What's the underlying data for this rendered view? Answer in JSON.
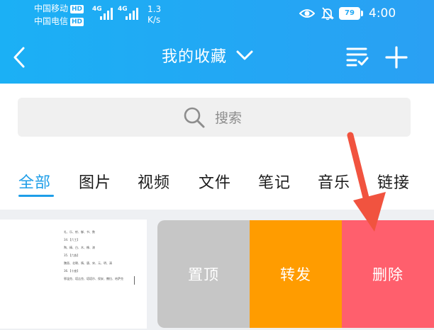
{
  "status_bar": {
    "carrier1": "中国移动",
    "carrier2": "中国电信",
    "hd_badge": "HD",
    "network": "4G",
    "speed_value": "1.3",
    "speed_unit": "K/s",
    "battery": "79",
    "time": "4:00"
  },
  "header": {
    "title": "我的收藏",
    "back_icon": "chevron-left-icon",
    "dropdown_icon": "chevron-down-icon",
    "sort_icon": "list-check-icon",
    "add_icon": "plus-icon"
  },
  "search": {
    "placeholder": "搜索",
    "icon": "search-icon"
  },
  "tabs": [
    {
      "label": "全部",
      "active": true
    },
    {
      "label": "图片",
      "active": false
    },
    {
      "label": "视频",
      "active": false
    },
    {
      "label": "文件",
      "active": false
    },
    {
      "label": "笔记",
      "active": false
    },
    {
      "label": "音乐",
      "active": false
    },
    {
      "label": "链接",
      "active": false
    }
  ],
  "item": {
    "thumbnail_lines": [
      "礼、乐、射、御、书、数",
      "34.【六工】",
      "陶、精、白、木、橡、漆",
      "35.【六族】",
      "魏晋、北朝、隋、唐、宋、元、明、清",
      "36.【十座】",
      "鄂温克、塔吉克、塔塔尔、保安、撒拉、哈萨克"
    ],
    "actions": {
      "pin": "置顶",
      "forward": "转发",
      "delete": "删除"
    }
  },
  "colors": {
    "header_blue": "#22a8f4",
    "tab_active": "#1e9ee8",
    "pin_gray": "#c6c6c6",
    "forward_orange": "#ff9c00",
    "delete_red": "#ff5f6d",
    "arrow_red": "#f1533f"
  }
}
